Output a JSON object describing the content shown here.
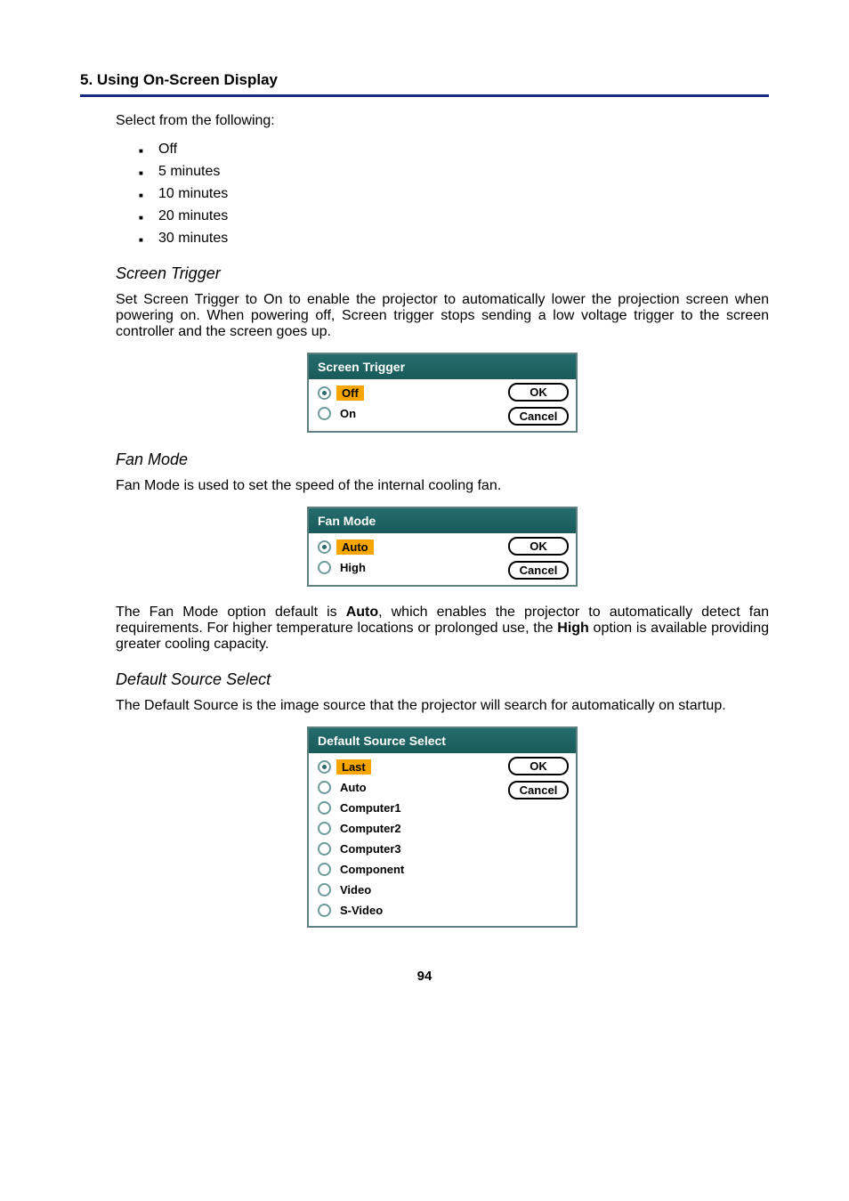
{
  "heading": "5. Using On-Screen Display",
  "intro": "Select from the following:",
  "bullets": [
    "Off",
    "5 minutes",
    "10 minutes",
    "20 minutes",
    "30 minutes"
  ],
  "screen_trigger": {
    "heading": "Screen Trigger",
    "text": "Set Screen Trigger to On to enable the projector to automatically lower the projection screen when powering on. When powering off, Screen trigger stops sending a low voltage trigger to the screen controller and the screen goes up.",
    "dialog_title": "Screen Trigger",
    "options": [
      "Off",
      "On"
    ],
    "selected_index": 0,
    "ok": "OK",
    "cancel": "Cancel"
  },
  "fan_mode": {
    "heading": "Fan Mode",
    "text_before": "Fan Mode is used to set the speed of the internal cooling fan.",
    "dialog_title": "Fan Mode",
    "options": [
      "Auto",
      "High"
    ],
    "selected_index": 0,
    "ok": "OK",
    "cancel": "Cancel",
    "text_after_1": "The Fan Mode option default is ",
    "text_after_bold1": "Auto",
    "text_after_2": ", which enables the projector to automatically detect fan requirements. For higher temperature locations or prolonged use, the ",
    "text_after_bold2": "High",
    "text_after_3": " option is available providing greater cooling capacity."
  },
  "default_source": {
    "heading": "Default Source Select",
    "text": "The Default Source is the image source that the projector will search for automatically on startup.",
    "dialog_title": "Default Source Select",
    "options": [
      "Last",
      "Auto",
      "Computer1",
      "Computer2",
      "Computer3",
      "Component",
      "Video",
      "S-Video"
    ],
    "selected_index": 0,
    "ok": "OK",
    "cancel": "Cancel"
  },
  "page_number": "94"
}
